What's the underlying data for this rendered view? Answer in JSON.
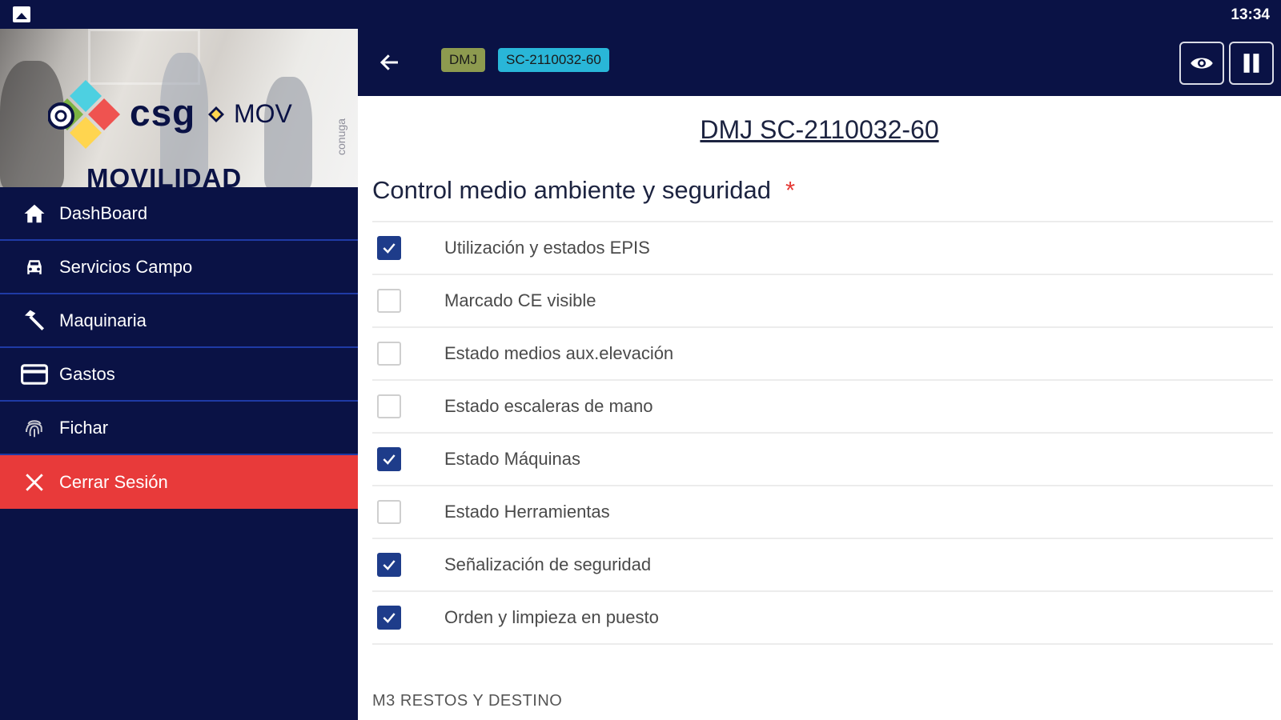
{
  "status_bar": {
    "time": "13:34",
    "left_icon": "image-icon"
  },
  "sidebar": {
    "brand": {
      "csg": "csg",
      "mov": "MOV",
      "movilidad": "MOVILIDAD",
      "vertical": "conuga"
    },
    "menu": [
      {
        "label": "DashBoard",
        "icon": "home-icon"
      },
      {
        "label": "Servicios Campo",
        "icon": "car-icon"
      },
      {
        "label": "Maquinaria",
        "icon": "hammer-icon"
      },
      {
        "label": "Gastos",
        "icon": "credit-card-icon"
      },
      {
        "label": "Fichar",
        "icon": "fingerprint-icon"
      },
      {
        "label": "Cerrar Sesión",
        "icon": "close-icon"
      }
    ]
  },
  "topbar": {
    "chip_1": "DMJ",
    "chip_2": "SC-2110032-60",
    "eye_icon": "eye-icon",
    "pause_icon": "pause-icon"
  },
  "main": {
    "title": "DMJ SC-2110032-60",
    "section_title": "Control medio ambiente y seguridad",
    "required_marker": "*",
    "checklist": [
      {
        "label": "Utilización y estados EPIS",
        "checked": true
      },
      {
        "label": "Marcado CE visible",
        "checked": false
      },
      {
        "label": "Estado medios aux.elevación",
        "checked": false
      },
      {
        "label": "Estado escaleras de mano",
        "checked": false
      },
      {
        "label": "Estado Máquinas",
        "checked": true
      },
      {
        "label": "Estado Herramientas",
        "checked": false
      },
      {
        "label": "Señalización de seguridad",
        "checked": true
      },
      {
        "label": "Orden y limpieza en puesto",
        "checked": true
      }
    ],
    "next_section": "M3 RESTOS Y DESTINO"
  },
  "colors": {
    "navy": "#0a1245",
    "danger": "#e83a3a",
    "chip_dmj": "#8d9a4f",
    "chip_code": "#29b6d8",
    "checked": "#1e3c8a"
  }
}
